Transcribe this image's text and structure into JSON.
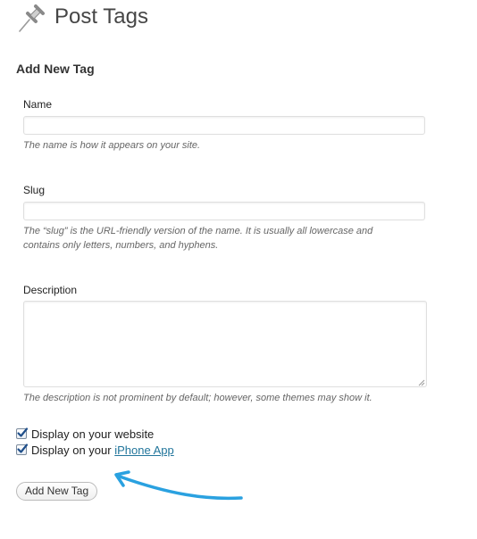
{
  "header": {
    "title": "Post Tags",
    "icon": "pushpin-icon"
  },
  "form": {
    "title": "Add New Tag",
    "name": {
      "label": "Name",
      "value": "",
      "help": "The name is how it appears on your site."
    },
    "slug": {
      "label": "Slug",
      "value": "",
      "help_line1": "The “slug” is the URL-friendly version of the name. It is usually all lowercase and",
      "help_line2": "contains only letters, numbers, and hyphens."
    },
    "description": {
      "label": "Description",
      "value": "",
      "help": "The description is not prominent by default; however, some themes may show it."
    },
    "checkboxes": [
      {
        "label": "Display on your website",
        "checked": true
      },
      {
        "label_prefix": "Display on your ",
        "link_text": "iPhone App",
        "checked": true
      }
    ],
    "submit_label": "Add New Tag"
  },
  "annotation": {
    "arrow_color": "#2aa1e0"
  },
  "colors": {
    "link": "#21759b",
    "help_text": "#666666"
  }
}
